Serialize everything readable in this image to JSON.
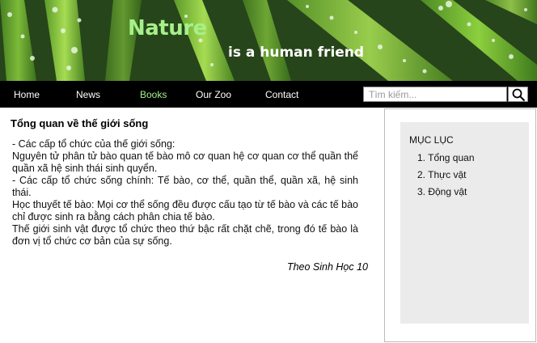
{
  "header": {
    "brand": "Nature",
    "tagline": "is a human friend"
  },
  "nav": {
    "items": [
      "Home",
      "News",
      "Books",
      "Our Zoo",
      "Contact"
    ],
    "active": "Books"
  },
  "search": {
    "placeholder": "Tìm kiếm..."
  },
  "article": {
    "title": "Tổng quan về thế giới sống",
    "paragraphs": [
      "- Các cấp tổ chức của thế giới sống:",
      "Nguyên tử  phân tử bào quan tế bào  mô  cơ quan  hệ cơ quan  cơ thể quần thể  quần xã  hệ sinh thái  sinh quyển.",
      "- Các cấp tổ chức sống chính: Tế bào, cơ thể, quần thể, quần xã, hệ sinh thái.",
      "Học thuyết tế bào: Mọi cơ thể sống đều được cấu tạo từ tế bào và các tế bào chỉ được sinh ra bằng cách phân chia tế bào.",
      "Thế giới sinh vật được tổ chức theo thứ bậc rất chặt chẽ, trong đó tế bào là đơn vị tổ chức cơ bản của sự sống."
    ],
    "source": "Theo Sinh Học 10"
  },
  "toc": {
    "title": "MỤC LỤC",
    "items": [
      "1. Tổng quan",
      "2. Thực vật",
      "3. Động vật"
    ]
  },
  "colors": {
    "brand": "#a6f08a",
    "nav_bg": "#000000",
    "toc_bg": "#ebebeb"
  }
}
